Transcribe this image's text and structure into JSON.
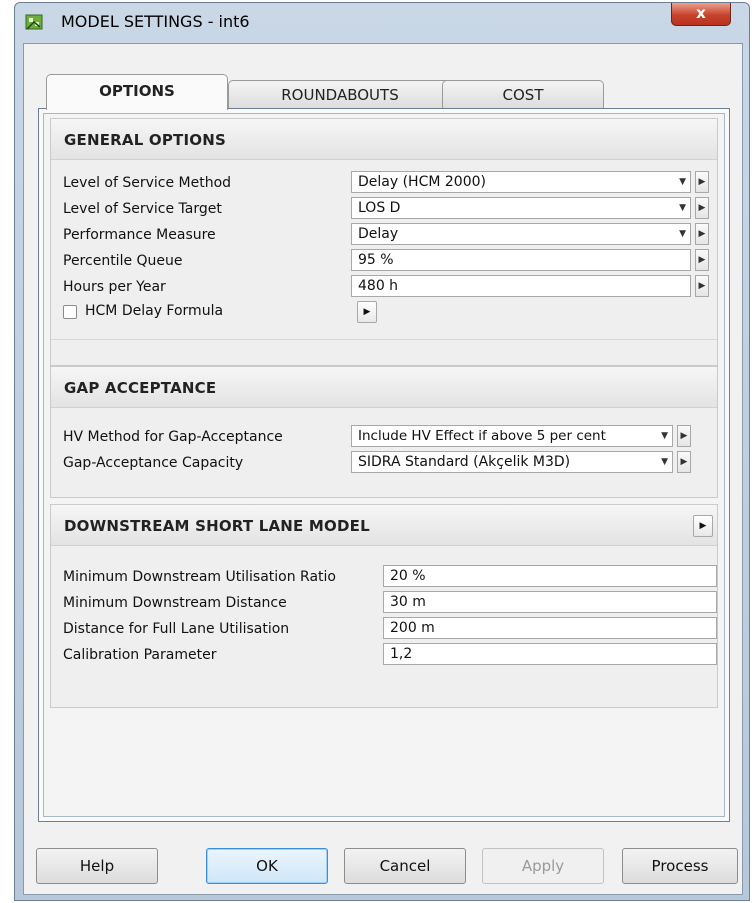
{
  "window": {
    "title": "MODEL SETTINGS - int6",
    "close_label": "x"
  },
  "tabs": [
    {
      "label": "OPTIONS",
      "active": true
    },
    {
      "label": "ROUNDABOUTS",
      "active": false
    },
    {
      "label": "COST",
      "active": false
    }
  ],
  "general_options": {
    "title": "GENERAL OPTIONS",
    "rows": [
      {
        "label": "Level of Service Method",
        "value": "Delay (HCM 2000)"
      },
      {
        "label": "Level of Service Target",
        "value": "LOS D"
      },
      {
        "label": "Performance Measure",
        "value": "Delay"
      },
      {
        "label": "Percentile Queue",
        "value": "95 %"
      },
      {
        "label": "Hours per Year",
        "value": "480 h"
      }
    ],
    "checkbox": {
      "label": "HCM Delay Formula",
      "checked": false
    }
  },
  "gap_acceptance": {
    "title": "GAP ACCEPTANCE",
    "rows": [
      {
        "label": "HV Method for Gap-Acceptance",
        "value": "Include HV Effect if above 5 per cent"
      },
      {
        "label": "Gap-Acceptance Capacity",
        "value": "SIDRA Standard (Akçelik M3D)"
      }
    ]
  },
  "downstream": {
    "title": "DOWNSTREAM SHORT LANE MODEL",
    "rows": [
      {
        "label": "Minimum Downstream Utilisation Ratio",
        "value": "20 %"
      },
      {
        "label": "Minimum Downstream Distance",
        "value": "30 m"
      },
      {
        "label": "Distance for Full Lane Utilisation",
        "value": "200 m"
      },
      {
        "label": "Calibration Parameter",
        "value": "1,2"
      }
    ]
  },
  "buttons": {
    "help": "Help",
    "ok": "OK",
    "cancel": "Cancel",
    "apply": "Apply",
    "process": "Process"
  },
  "icons": {
    "dropdown": "chevron-down-icon",
    "expand": "play-right-icon",
    "app": "app-icon"
  }
}
